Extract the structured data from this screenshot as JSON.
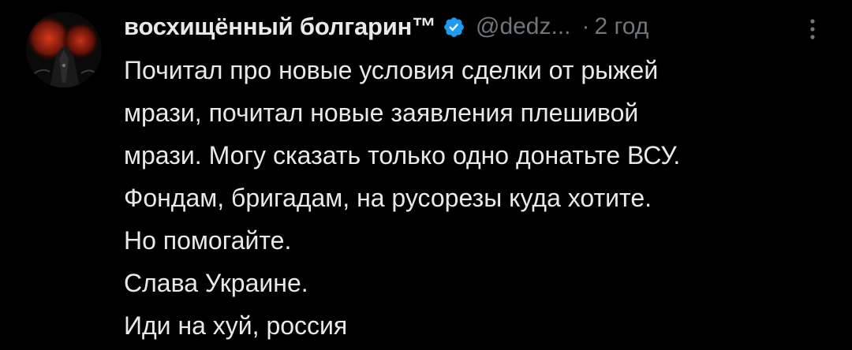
{
  "post": {
    "author": {
      "display_name": "восхищённый болгарин™",
      "verified": true,
      "handle": "@dedz...",
      "avatar_icon": "avatar-image"
    },
    "separator": "·",
    "time": "2 год",
    "more_icon": "more-icon",
    "lines": [
      "Почитал про новые условия сделки от рыжей",
      "мрази, почитал новые заявления плешивой",
      "мрази. Могу сказать только одно донатьте ВСУ.",
      "Фондам, бригадам, на русорезы куда хотите.",
      "Но помогайте.",
      "Слава Украине.",
      "Иди на хуй, россия"
    ]
  },
  "colors": {
    "background": "#000000",
    "text": "#e7e9ea",
    "muted": "#71767b",
    "verified": "#1d9bf0"
  }
}
